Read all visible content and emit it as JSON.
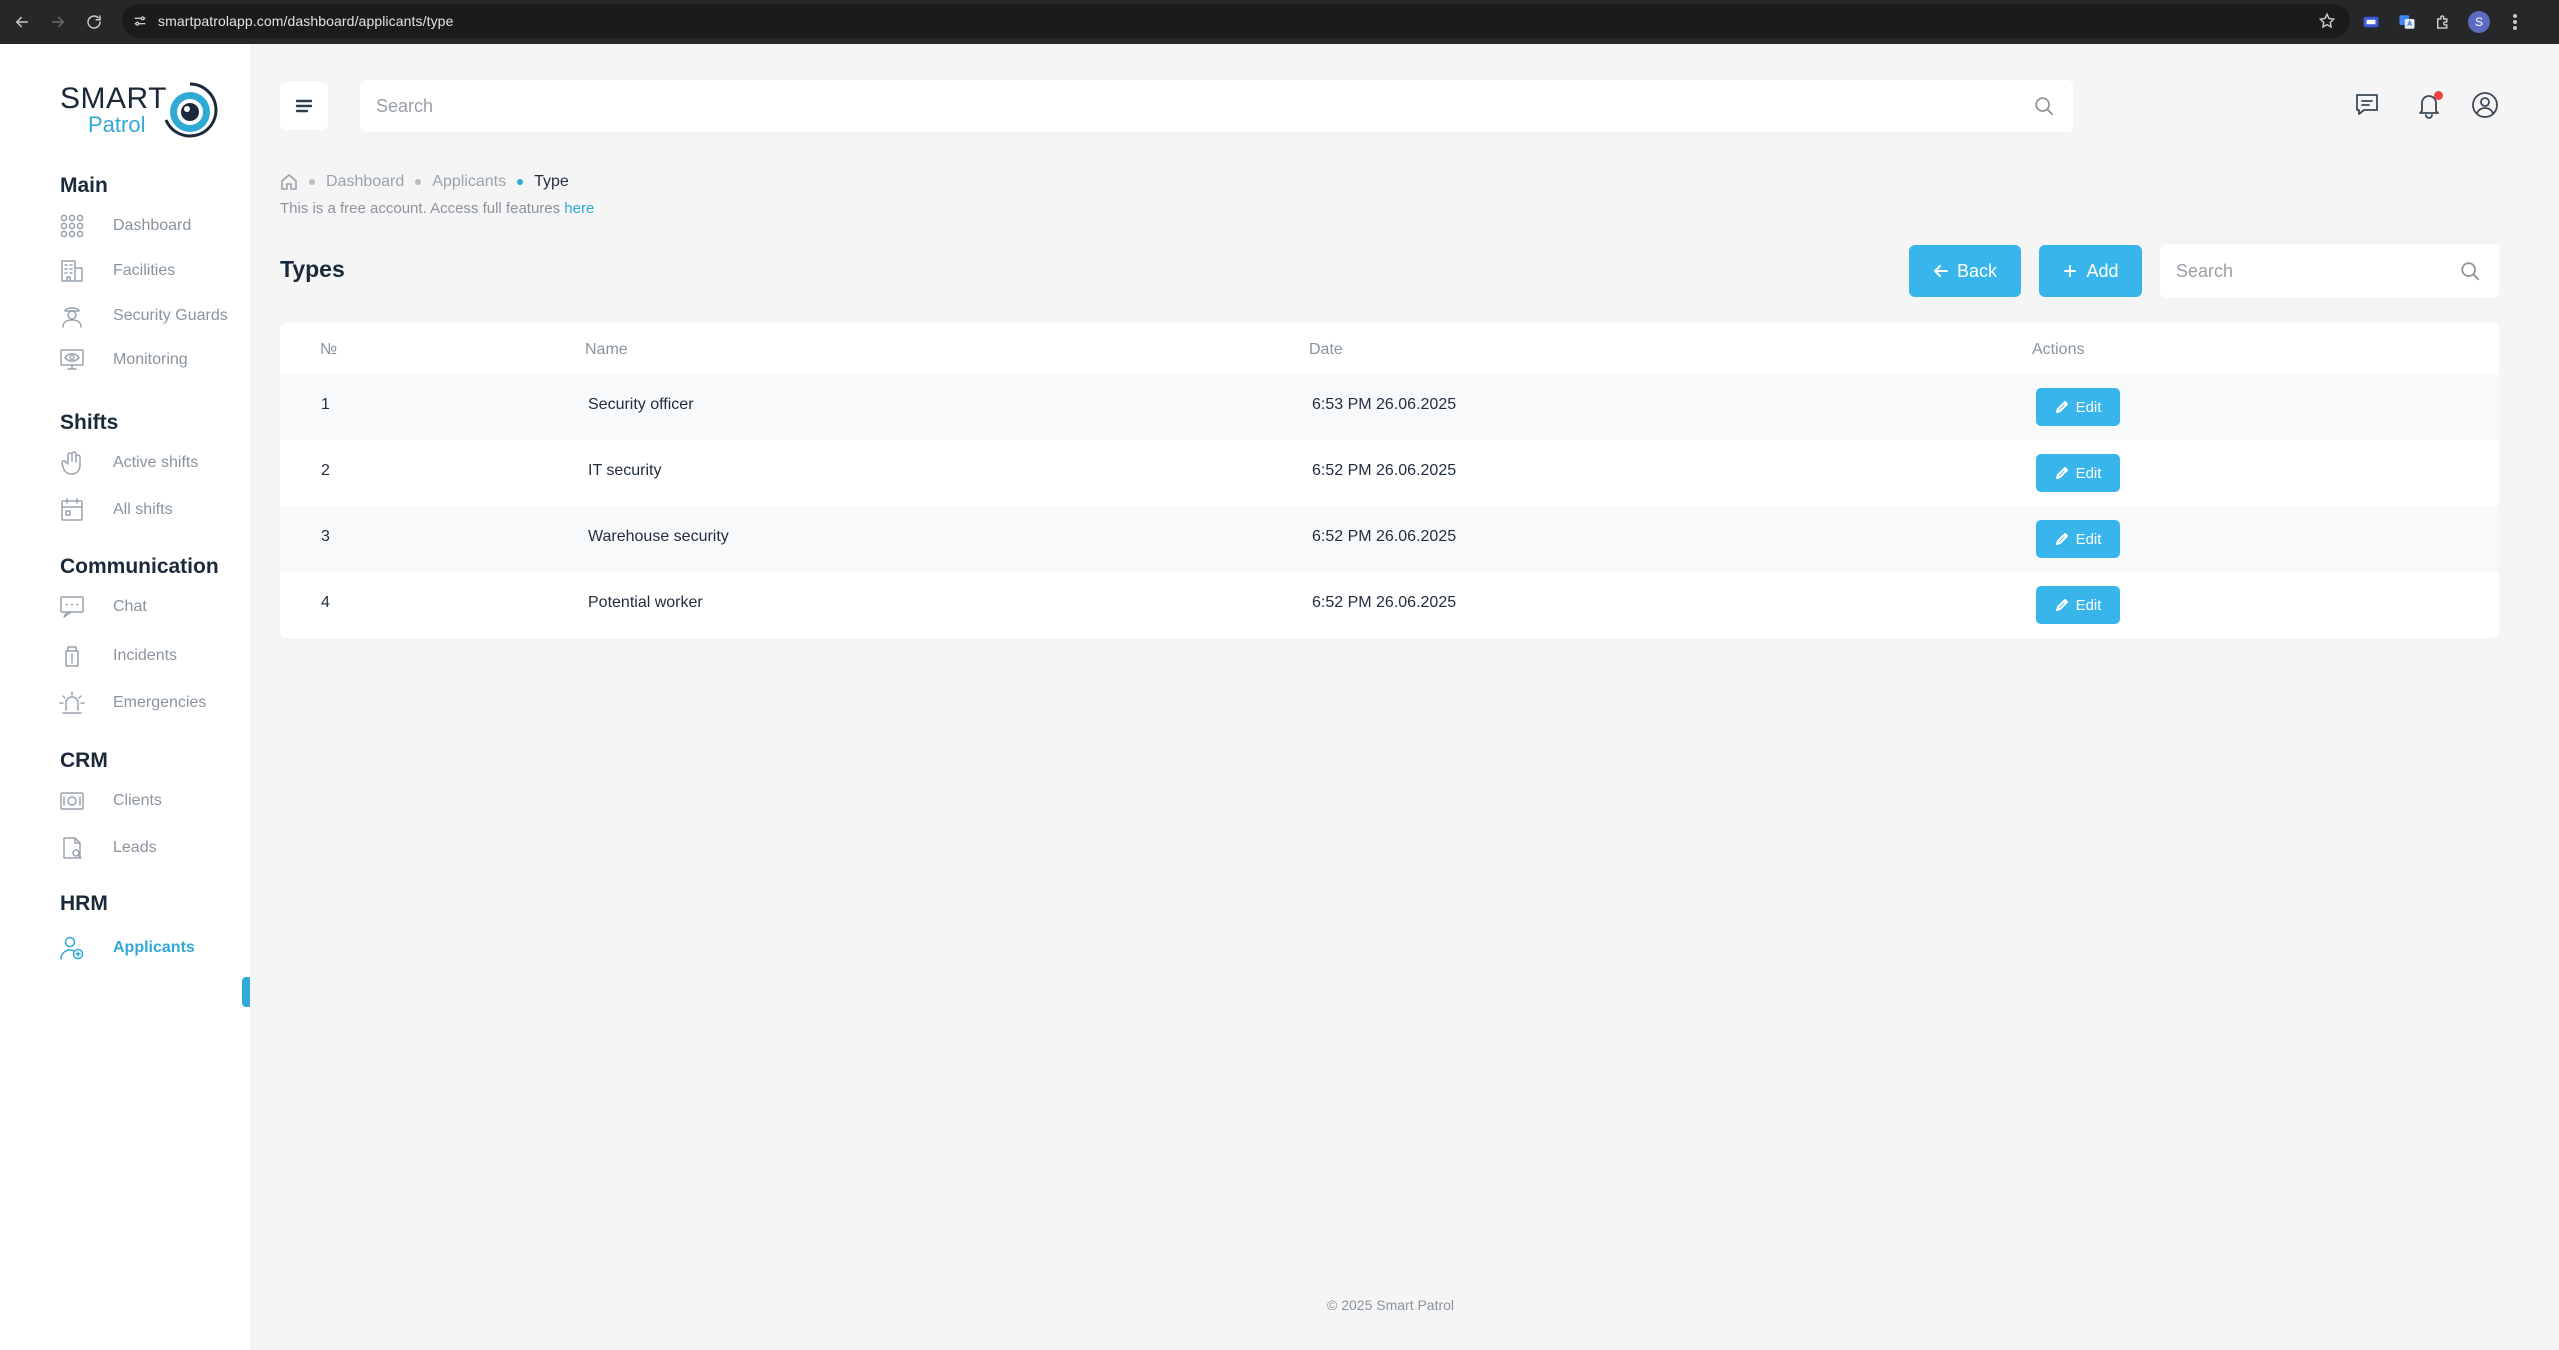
{
  "browser": {
    "url": "smartpatrolapp.com/dashboard/applicants/type",
    "profile_initial": "S"
  },
  "logo": {
    "line1": "SMART",
    "line2": "Patrol"
  },
  "sidebar": {
    "sections": [
      {
        "title": "Main",
        "items": [
          {
            "label": "Dashboard",
            "icon": "grid-icon"
          },
          {
            "label": "Facilities",
            "icon": "building-icon"
          },
          {
            "label": "Security Guards",
            "icon": "guard-icon"
          },
          {
            "label": "Monitoring",
            "icon": "monitor-eye-icon"
          }
        ]
      },
      {
        "title": "Shifts",
        "items": [
          {
            "label": "Active shifts",
            "icon": "hand-icon"
          },
          {
            "label": "All shifts",
            "icon": "calendar-icon"
          }
        ]
      },
      {
        "title": "Communication",
        "items": [
          {
            "label": "Chat",
            "icon": "chat-icon"
          },
          {
            "label": "Incidents",
            "icon": "incident-icon"
          },
          {
            "label": "Emergencies",
            "icon": "siren-icon"
          }
        ]
      },
      {
        "title": "CRM",
        "items": [
          {
            "label": "Clients",
            "icon": "money-icon"
          },
          {
            "label": "Leads",
            "icon": "lead-icon"
          }
        ]
      },
      {
        "title": "HRM",
        "items": [
          {
            "label": "Applicants",
            "icon": "applicant-icon",
            "active": true
          }
        ]
      }
    ]
  },
  "header": {
    "search_placeholder": "Search"
  },
  "breadcrumb": {
    "items": [
      "Dashboard",
      "Applicants"
    ],
    "current": "Type"
  },
  "notice": {
    "text": "This is a free account. Access full features ",
    "link": "here"
  },
  "page": {
    "title": "Types",
    "back_label": "Back",
    "add_label": "Add",
    "search_placeholder": "Search"
  },
  "table": {
    "columns": [
      "№",
      "Name",
      "Date",
      "Actions"
    ],
    "rows": [
      {
        "no": "1",
        "name": "Security officer",
        "date": "6:53 PM 26.06.2025",
        "action": "Edit"
      },
      {
        "no": "2",
        "name": "IT security",
        "date": "6:52 PM 26.06.2025",
        "action": "Edit"
      },
      {
        "no": "3",
        "name": "Warehouse security",
        "date": "6:52 PM 26.06.2025",
        "action": "Edit"
      },
      {
        "no": "4",
        "name": "Potential worker",
        "date": "6:52 PM 26.06.2025",
        "action": "Edit"
      }
    ]
  },
  "footer": {
    "text": "© 2025 Smart Patrol"
  },
  "colors": {
    "accent": "#38b6ec",
    "active": "#31a9d6",
    "background": "#f5f5f5",
    "notification": "#ef4444"
  }
}
